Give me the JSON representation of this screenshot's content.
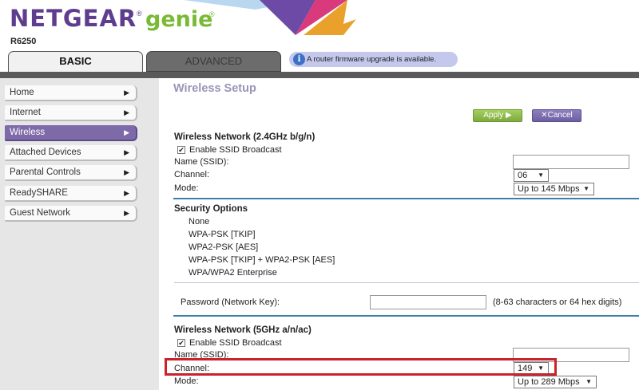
{
  "header": {
    "brand": "NETGEAR",
    "brand_reg": "®",
    "product": "genie",
    "product_reg": "®",
    "model": "R6250"
  },
  "tabs": [
    {
      "label": "BASIC",
      "active": true
    },
    {
      "label": "ADVANCED",
      "active": false
    }
  ],
  "notice": {
    "icon": "info-icon",
    "icon_glyph": "i",
    "text": "A router firmware upgrade is available."
  },
  "sidebar": {
    "items": [
      {
        "label": "Home",
        "active": false
      },
      {
        "label": "Internet",
        "active": false
      },
      {
        "label": "Wireless",
        "active": true
      },
      {
        "label": "Attached Devices",
        "active": false
      },
      {
        "label": "Parental Controls",
        "active": false
      },
      {
        "label": "ReadySHARE",
        "active": false
      },
      {
        "label": "Guest Network",
        "active": false
      }
    ],
    "arrow_glyph": "▶"
  },
  "main": {
    "title": "Wireless Setup",
    "apply_label": "Apply ▶",
    "cancel_label": "✕Cancel",
    "band24": {
      "title": "Wireless Network (2.4GHz b/g/n)",
      "ssid_broadcast_label": "Enable SSID Broadcast",
      "ssid_broadcast_checked": true,
      "name_label": "Name (SSID):",
      "name_value": "",
      "channel_label": "Channel:",
      "channel_value": "06",
      "mode_label": "Mode:",
      "mode_value": "Up to 145 Mbps"
    },
    "security": {
      "title": "Security Options",
      "options": [
        "None",
        "WPA-PSK [TKIP]",
        "WPA2-PSK [AES]",
        "WPA-PSK [TKIP] + WPA2-PSK [AES]",
        "WPA/WPA2 Enterprise"
      ],
      "password_label": "Password (Network Key):",
      "password_value": "",
      "password_hint": "(8-63 characters or 64 hex digits)"
    },
    "band5": {
      "title": "Wireless Network (5GHz a/n/ac)",
      "ssid_broadcast_label": "Enable SSID Broadcast",
      "ssid_broadcast_checked": true,
      "name_label": "Name (SSID):",
      "name_value": "",
      "channel_label": "Channel:",
      "channel_value": "149",
      "mode_label": "Mode:",
      "mode_value": "Up to 289 Mbps"
    },
    "caret_glyph": "▼",
    "check_glyph": "✔"
  },
  "colors": {
    "brand_purple": "#5e3d8f",
    "genie_green": "#79b934",
    "active_nav": "#7f6aa9",
    "apply_green": "#7eaa3e",
    "cancel_purple": "#6e5fa3",
    "highlight_red": "#c8232b",
    "separator_blue": "#3e7ea6"
  }
}
